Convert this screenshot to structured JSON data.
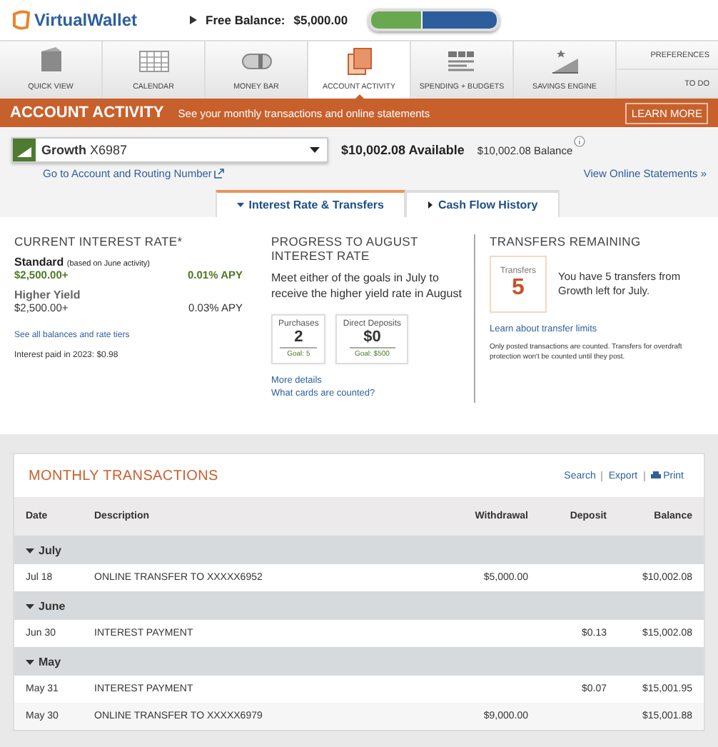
{
  "header": {
    "logo": "VirtualWallet",
    "free_balance_label": "Free Balance:",
    "free_balance": "$5,000.00"
  },
  "nav": {
    "items": [
      {
        "label": "QUICK VIEW",
        "selected": false
      },
      {
        "label": "CALENDAR",
        "selected": false
      },
      {
        "label": "MONEY BAR",
        "selected": false
      },
      {
        "label": "ACCOUNT ACTIVITY",
        "selected": true
      },
      {
        "label": "SPENDING + BUDGETS",
        "selected": false
      },
      {
        "label": "SAVINGS ENGINE",
        "selected": false
      }
    ],
    "side_links": [
      "PREFERENCES",
      "TO DO"
    ]
  },
  "banner": {
    "title": "ACCOUNT ACTIVITY",
    "subtitle": "See your monthly transactions and online statements",
    "button": "LEARN MORE"
  },
  "account": {
    "name": "Growth",
    "number": "X6987",
    "available": "$10,002.08 Available",
    "balance": "$10,002.08 Balance",
    "routing_link": "Go to Account and Routing Number",
    "statements_link": "View Online Statements »"
  },
  "tabs": [
    {
      "label": "Interest Rate & Transfers",
      "selected": true
    },
    {
      "label": "Cash Flow History",
      "selected": false
    }
  ],
  "interest": {
    "title": "CURRENT INTEREST RATE*",
    "tiers": [
      {
        "name": "Standard",
        "note": "(based on June activity)",
        "amount": "$2,500.00+",
        "rate": "0.01% APY",
        "selected": true
      },
      {
        "name": "Higher Yield",
        "amount": "$2,500.00+",
        "rate": "0.03% APY",
        "selected": false
      }
    ],
    "link": "See all balances and rate tiers",
    "paid": "Interest paid in 2023: $0.98"
  },
  "progress": {
    "title": "PROGRESS TO AUGUST INTEREST RATE",
    "text": "Meet either of the goals in July to receive the higher yield rate in August",
    "goals": [
      {
        "label": "Purchases",
        "value": "2",
        "goal": "Goal: 5"
      },
      {
        "label": "Direct Deposits",
        "value": "$0",
        "goal": "Goal: $500"
      }
    ],
    "links": [
      "More details",
      "What cards are counted?"
    ]
  },
  "transfers": {
    "title": "TRANSFERS REMAINING",
    "label": "Transfers",
    "count": "5",
    "text": "You have 5 transfers from Growth left for July.",
    "link": "Learn about transfer limits",
    "note": "Only posted transactions are counted. Transfers for overdraft protection won't be counted until they post."
  },
  "transactions": {
    "title": "MONTHLY TRANSACTIONS",
    "actions": [
      "Search",
      "Export",
      "Print"
    ],
    "columns": [
      "Date",
      "Description",
      "Withdrawal",
      "Deposit",
      "Balance"
    ],
    "groups": [
      {
        "month": "July",
        "expanded": true,
        "rows": [
          [
            "Jul 18",
            "ONLINE TRANSFER TO XXXXX6952",
            "$5,000.00",
            "",
            "$10,002.08"
          ]
        ]
      },
      {
        "month": "June",
        "expanded": true,
        "rows": [
          [
            "Jun 30",
            "INTEREST PAYMENT",
            "",
            "$0.13",
            "$15,002.08"
          ]
        ]
      },
      {
        "month": "May",
        "expanded": true,
        "rows": [
          [
            "May 31",
            "INTEREST PAYMENT",
            "",
            "$0.07",
            "$15,001.95"
          ],
          [
            "May 30",
            "ONLINE TRANSFER TO XXXXX6979",
            "$9,000.00",
            "",
            "$15,001.88"
          ]
        ]
      }
    ]
  }
}
